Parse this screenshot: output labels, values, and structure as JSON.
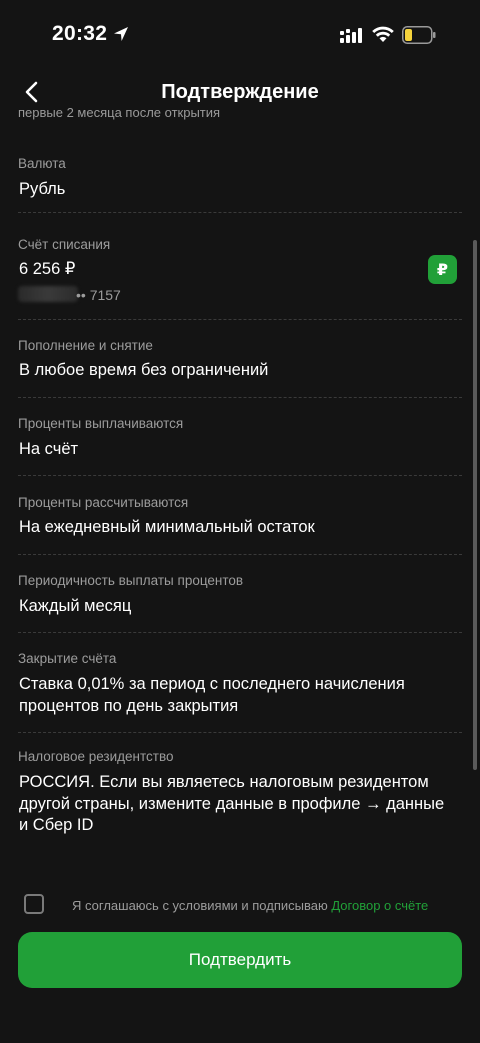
{
  "status_bar": {
    "time": "20:32",
    "battery_color": "#f5d33c"
  },
  "header": {
    "title": "Подтверждение"
  },
  "content": {
    "cut_text": "первые 2 месяца после открытия",
    "currency": {
      "label": "Валюта",
      "value": "Рубль"
    },
    "account": {
      "label": "Счёт списания",
      "balance": "6 256 ₽",
      "number_suffix": "•• 7157",
      "badge": "₽"
    },
    "replenishment": {
      "label": "Пополнение и снятие",
      "value": "В любое время без ограничений"
    },
    "interest_paid": {
      "label": "Проценты выплачиваются",
      "value": "На счёт"
    },
    "interest_calc": {
      "label": "Проценты рассчитываются",
      "value": "На ежедневный минимальный остаток"
    },
    "payout_period": {
      "label": "Периодичность выплаты процентов",
      "value": "Каждый месяц"
    },
    "closing": {
      "label": "Закрытие счёта",
      "value": "Ставка 0,01% за период с последнего начисления процентов по день закрытия"
    },
    "tax": {
      "label": "Налоговое резидентство",
      "value": "РОССИЯ. Если вы являетесь налоговым резидентом другой страны, измените данные в профиле → данные и Сбер ID"
    }
  },
  "agreement": {
    "text": "Я соглашаюсь с условиями и подписываю",
    "link": "Договор о счёте"
  },
  "confirm_button": {
    "label": "Подтвердить"
  },
  "colors": {
    "accent": "#21a038",
    "background": "#141414",
    "label": "#9c9c9c"
  }
}
